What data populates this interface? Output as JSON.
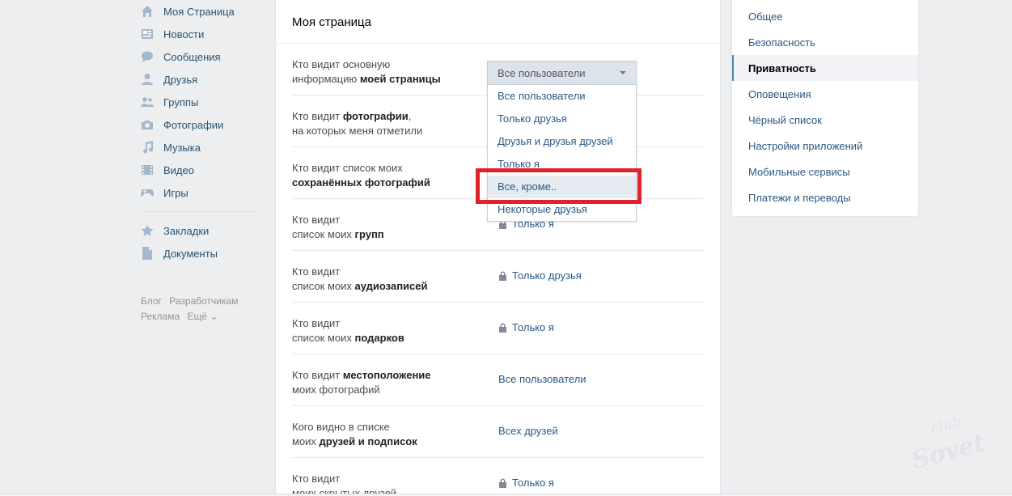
{
  "left_nav": {
    "items": [
      {
        "label": "Моя Страница",
        "icon": "home-icon"
      },
      {
        "label": "Новости",
        "icon": "news-icon"
      },
      {
        "label": "Сообщения",
        "icon": "messages-icon"
      },
      {
        "label": "Друзья",
        "icon": "user-icon"
      },
      {
        "label": "Группы",
        "icon": "users-icon"
      },
      {
        "label": "Фотографии",
        "icon": "camera-icon"
      },
      {
        "label": "Музыка",
        "icon": "music-icon"
      },
      {
        "label": "Видео",
        "icon": "video-icon"
      },
      {
        "label": "Игры",
        "icon": "gamepad-icon"
      }
    ],
    "items2": [
      {
        "label": "Закладки",
        "icon": "star-icon"
      },
      {
        "label": "Документы",
        "icon": "document-icon"
      }
    ],
    "footer": {
      "blog": "Блог",
      "developers": "Разработчикам",
      "ads": "Реклама",
      "more": "Ещё ⌄"
    }
  },
  "main": {
    "title": "Моя страница",
    "rows": [
      {
        "label_plain": "Кто видит основную",
        "label_plain2": "информацию ",
        "label_bold": "моей страницы",
        "value": ""
      },
      {
        "label_plain": "Кто видит ",
        "label_bold": "фотографии",
        "label_plain2": ",",
        "label_plain3": "на которых меня отметили",
        "value": ""
      },
      {
        "label_plain": "Кто видит список моих",
        "label_bold": "сохранённых фотографий",
        "value": ""
      },
      {
        "label_plain": "Кто видит",
        "label_plain2": "список моих ",
        "label_bold": "групп",
        "value": "Только я",
        "locked": true
      },
      {
        "label_plain": "Кто видит",
        "label_plain2": "список моих ",
        "label_bold": "аудиозаписей",
        "value": "Только друзья",
        "locked": true
      },
      {
        "label_plain": "Кто видит",
        "label_plain2": "список моих ",
        "label_bold": "подарков",
        "value": "Только я",
        "locked": true
      },
      {
        "label_plain": "Кто видит ",
        "label_bold": "местоположение",
        "label_plain2": "моих фотографий",
        "value": "Все пользователи",
        "locked": false
      },
      {
        "label_plain": "Кого видно в списке",
        "label_plain2": "моих ",
        "label_bold": "друзей и подписок",
        "value": "Всех друзей",
        "locked": false
      },
      {
        "label_plain": "Кто видит",
        "label_plain2": "моих скрытых друзей",
        "value": "Только я",
        "locked": true
      }
    ]
  },
  "dropdown": {
    "selected": "Все пользователи",
    "options": [
      "Все пользователи",
      "Только друзья",
      "Друзья и друзья друзей",
      "Только я",
      "Все, кроме..",
      "Некоторые друзья"
    ],
    "hovered_index": 4
  },
  "right_menu": {
    "items": [
      {
        "label": "Общее",
        "active": false
      },
      {
        "label": "Безопасность",
        "active": false
      },
      {
        "label": "Приватность",
        "active": true
      },
      {
        "label": "Оповещения",
        "active": false
      },
      {
        "label": "Чёрный список",
        "active": false
      },
      {
        "label": "Настройки приложений",
        "active": false
      },
      {
        "label": "Мобильные сервисы",
        "active": false
      },
      {
        "label": "Платежи и переводы",
        "active": false
      }
    ]
  },
  "colors": {
    "link": "#2a5885",
    "accent": "#5181b8",
    "highlight": "#e0232a",
    "background": "#edeef0"
  },
  "watermark": {
    "line1": "club",
    "line2": "Sovet"
  }
}
